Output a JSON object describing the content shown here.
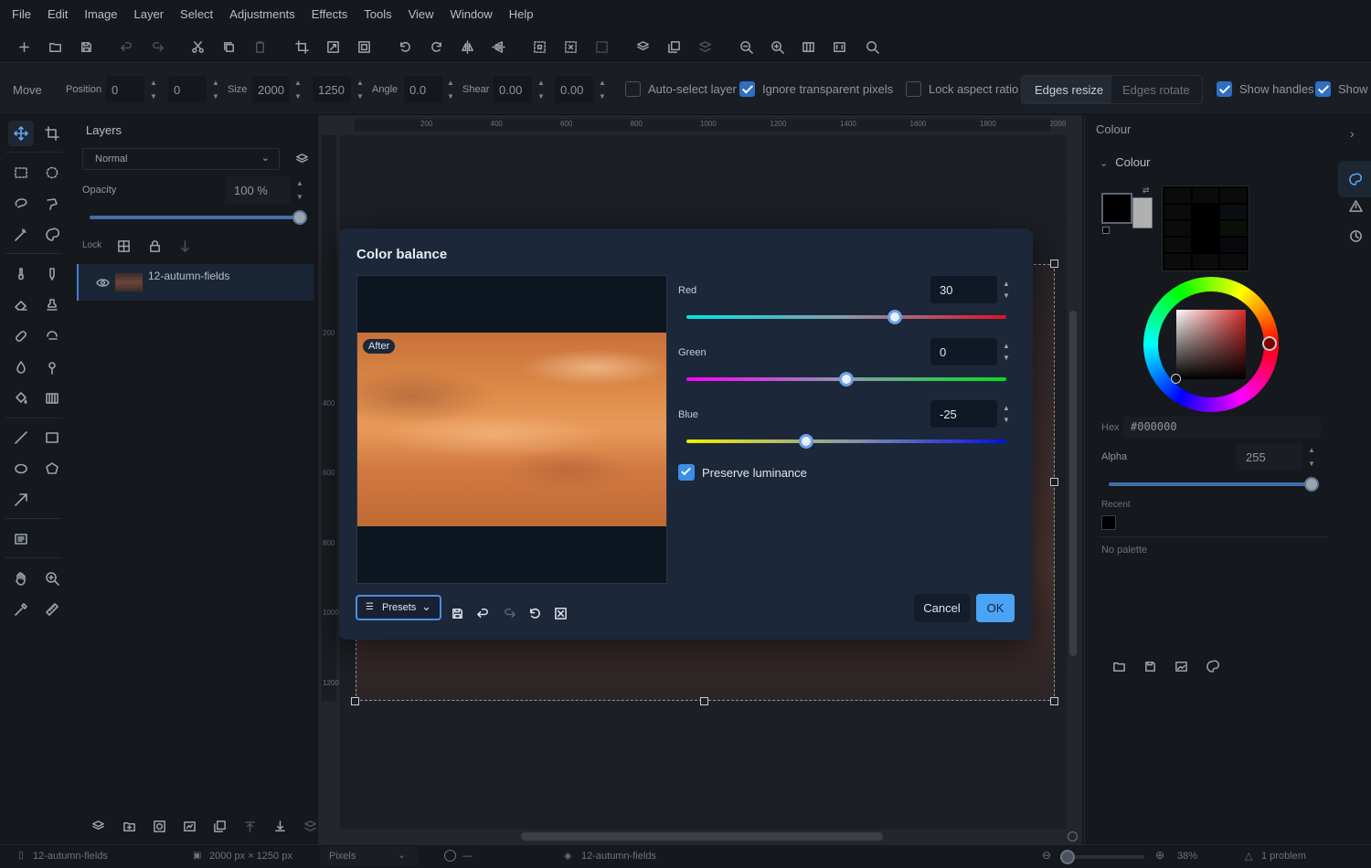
{
  "menu": [
    "File",
    "Edit",
    "Image",
    "Layer",
    "Select",
    "Adjustments",
    "Effects",
    "Tools",
    "View",
    "Window",
    "Help"
  ],
  "options": {
    "tool_name": "Move",
    "position_label": "Position",
    "pos_x": "0",
    "pos_y": "0",
    "size_label": "Size",
    "width": "2000",
    "height": "1250",
    "angle_label": "Angle",
    "angle": "0.0",
    "shear_label": "Shear",
    "shear_x": "0.00",
    "shear_y": "0.00",
    "auto_select": "Auto-select layer",
    "ignore_transparent": "Ignore transparent pixels",
    "lock_aspect": "Lock aspect ratio",
    "edges_resize": "Edges resize",
    "edges_rotate": "Edges rotate",
    "show_handles": "Show handles",
    "show_truncated": "Show"
  },
  "layers": {
    "title": "Layers",
    "blend_mode": "Normal",
    "opacity_label": "Opacity",
    "opacity_value": "100 %",
    "opacity_fraction": 1.0,
    "lock_label": "Lock",
    "items": [
      {
        "name": "12-autumn-fields"
      }
    ]
  },
  "rulers": {
    "top": [
      "200",
      "400",
      "600",
      "800",
      "1000",
      "1200",
      "1400",
      "1600",
      "1800",
      "2000"
    ],
    "left": [
      "200",
      "400",
      "600",
      "800",
      "1000",
      "1200"
    ]
  },
  "dialog": {
    "title": "Color balance",
    "preview_badge": "After",
    "red_label": "Red",
    "red_value": "30",
    "green_label": "Green",
    "green_value": "0",
    "blue_label": "Blue",
    "blue_value": "-25",
    "red_fraction": 0.65,
    "green_fraction": 0.5,
    "blue_fraction": 0.375,
    "preserve_label": "Preserve luminance",
    "preserve_checked": true,
    "presets_label": "Presets",
    "cancel_label": "Cancel",
    "ok_label": "OK"
  },
  "colour": {
    "panel_title": "Colour",
    "section_title": "Colour",
    "hex_label": "Hex",
    "hex_value": "#000000",
    "alpha_label": "Alpha",
    "alpha_value": "255",
    "alpha_fraction": 1.0,
    "recent_label": "Recent",
    "palette_label": "No palette",
    "primary_color": "#000000",
    "secondary_color": "#b0b0b0"
  },
  "status": {
    "file": "12-autumn-fields",
    "dimensions": "2000 px × 1250 px",
    "units": "Pixels",
    "cursor": "—",
    "layer": "12-autumn-fields",
    "zoom": "38%",
    "problems": "1 problem"
  },
  "colors": {
    "accent": "#4a9ff0",
    "dialog_bg": "#1c2739",
    "checkbox": "#2e6fc4"
  }
}
